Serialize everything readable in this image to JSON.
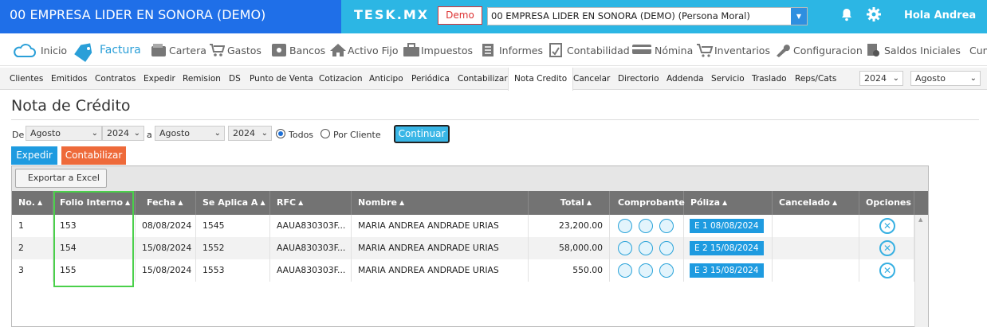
{
  "header": {
    "company_title": "00 EMPRESA LIDER EN SONORA (DEMO)",
    "app_name": "TESK.MX",
    "demo_label": "Demo",
    "company_select": "00 EMPRESA LIDER EN SONORA (DEMO) (Persona Moral)",
    "greeting": "Hola Andrea"
  },
  "main_nav": [
    {
      "label": "Inicio",
      "icon": "cloud-icon"
    },
    {
      "label": "Factura",
      "icon": "tag-icon"
    },
    {
      "label": "Cartera",
      "icon": "wallet-icon"
    },
    {
      "label": "Gastos",
      "icon": "cart-icon"
    },
    {
      "label": "Bancos",
      "icon": "safe-icon"
    },
    {
      "label": "Activo Fijo",
      "icon": "house-icon"
    },
    {
      "label": "Impuestos",
      "icon": "briefcase-icon"
    },
    {
      "label": "Informes",
      "icon": "list-icon"
    },
    {
      "label": "Contabilidad",
      "icon": "ledger-icon"
    },
    {
      "label": "Nómina",
      "icon": "card-icon"
    },
    {
      "label": "Inventarios",
      "icon": "cart-icon"
    },
    {
      "label": "Configuracion",
      "icon": "wrench-icon"
    },
    {
      "label": "Saldos Iniciales",
      "icon": "doc-check-icon"
    },
    {
      "label": "Cum",
      "icon": ""
    }
  ],
  "sub_nav": [
    "Clientes",
    "Emitidos",
    "Contratos",
    "Expedir",
    "Remision",
    "DS",
    "Punto de Venta",
    "Cotizacion",
    "Anticipo",
    "Periódica",
    "Contabilizar",
    "Nota Credito",
    "Cancelar",
    "Directorio",
    "Addenda",
    "Servicio",
    "Traslado",
    "Reps/Cats"
  ],
  "sub_nav_year": "2024",
  "sub_nav_month": "Agosto",
  "page": {
    "title": "Nota de Crédito",
    "filter": {
      "de_label": "De",
      "a_label": "a",
      "from_month": "Agosto",
      "from_year": "2024",
      "to_month": "Agosto",
      "to_year": "2024",
      "radio_todos": "Todos",
      "radio_cliente": "Por Cliente",
      "continue_label": "Continuar"
    },
    "tab_expedir": "Expedir",
    "tab_contabilizar": "Contabilizar",
    "export_label": "Exportar a Excel"
  },
  "table": {
    "headers": [
      "No.",
      "Folio Interno",
      "Fecha",
      "Se Aplica A",
      "RFC",
      "Nombre",
      "Total",
      "Comprobante",
      "Póliza",
      "Cancelado",
      "Opciones"
    ],
    "rows": [
      {
        "no": "1",
        "folio": "153",
        "fecha": "08/08/2024",
        "aplica": "1545",
        "rfc": "AAUA830303F...",
        "nombre": "MARIA ANDREA ANDRADE URIAS",
        "total": "23,200.00",
        "poliza": "E 1 08/08/2024",
        "cancelado": ""
      },
      {
        "no": "2",
        "folio": "154",
        "fecha": "15/08/2024",
        "aplica": "1552",
        "rfc": "AAUA830303F...",
        "nombre": "MARIA ANDREA ANDRADE URIAS",
        "total": "58,000.00",
        "poliza": "E 2 15/08/2024",
        "cancelado": ""
      },
      {
        "no": "3",
        "folio": "155",
        "fecha": "15/08/2024",
        "aplica": "1553",
        "rfc": "AAUA830303F...",
        "nombre": "MARIA ANDREA ANDRADE URIAS",
        "total": "550.00",
        "poliza": "E 3 15/08/2024",
        "cancelado": ""
      }
    ]
  },
  "colors": {
    "brand_blue": "#1f6fe8",
    "top_cyan": "#2cb6e4",
    "highlight_green": "#4ad04a",
    "poliza_blue": "#1e9be0"
  }
}
